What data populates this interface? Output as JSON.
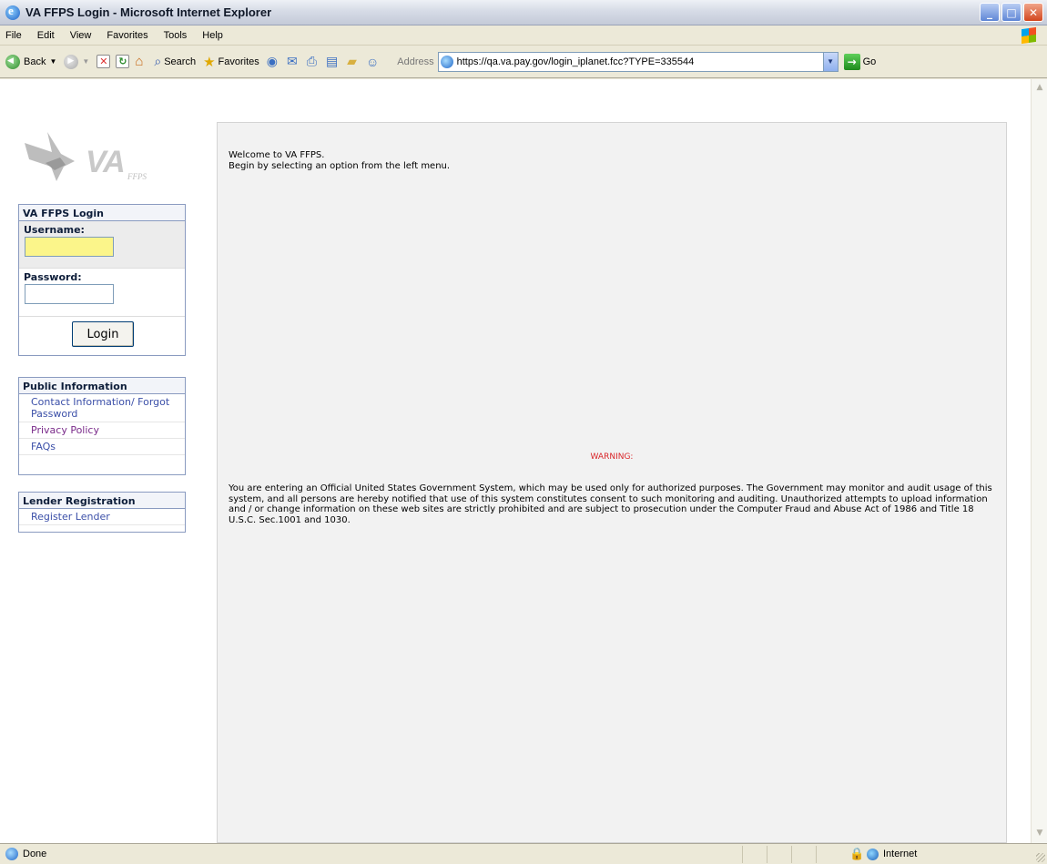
{
  "window": {
    "title": "VA FFPS Login - Microsoft Internet Explorer",
    "buttons": [
      "_",
      "□",
      "✕"
    ]
  },
  "menu": [
    "File",
    "Edit",
    "View",
    "Favorites",
    "Tools",
    "Help"
  ],
  "toolbar": {
    "back_label": "Back",
    "search_label": "Search",
    "favorites_label": "Favorites",
    "address_label": "Address",
    "url": "https://qa.va.pay.gov/login_iplanet.fcc?TYPE=335544",
    "go_label": "Go"
  },
  "logo": {
    "text": "VA",
    "sub": "FFPS"
  },
  "login_panel": {
    "title": "VA FFPS Login",
    "username_label": "Username:",
    "username_value": "",
    "password_label": "Password:",
    "password_value": "",
    "login_button": "Login"
  },
  "public_panel": {
    "title": "Public Information",
    "links": [
      "Contact Information/ Forgot Password",
      "Privacy Policy",
      "FAQs"
    ]
  },
  "registration_panel": {
    "title": "Lender Registration",
    "links": [
      "Register Lender"
    ]
  },
  "main": {
    "welcome_line1": "Welcome to VA FFPS.",
    "welcome_line2": "Begin by selecting an option from the left menu.",
    "warning_title": "WARNING:",
    "warning_text": "You are entering an Official United States Government System, which may be used only for authorized purposes. The Government may monitor and audit usage of this system, and all persons are hereby notified that use of this system constitutes consent to such monitoring and auditing. Unauthorized attempts to upload information and / or change information on these web sites are strictly prohibited and are subject to prosecution under the Computer Fraud and Abuse Act of 1986 and Title 18 U.S.C. Sec.1001 and 1030."
  },
  "statusbar": {
    "status": "Done",
    "zone": "Internet"
  },
  "colors": {
    "warning": "#d9262a",
    "username_field": "#fbf58a",
    "link": "#3b4fa8"
  }
}
